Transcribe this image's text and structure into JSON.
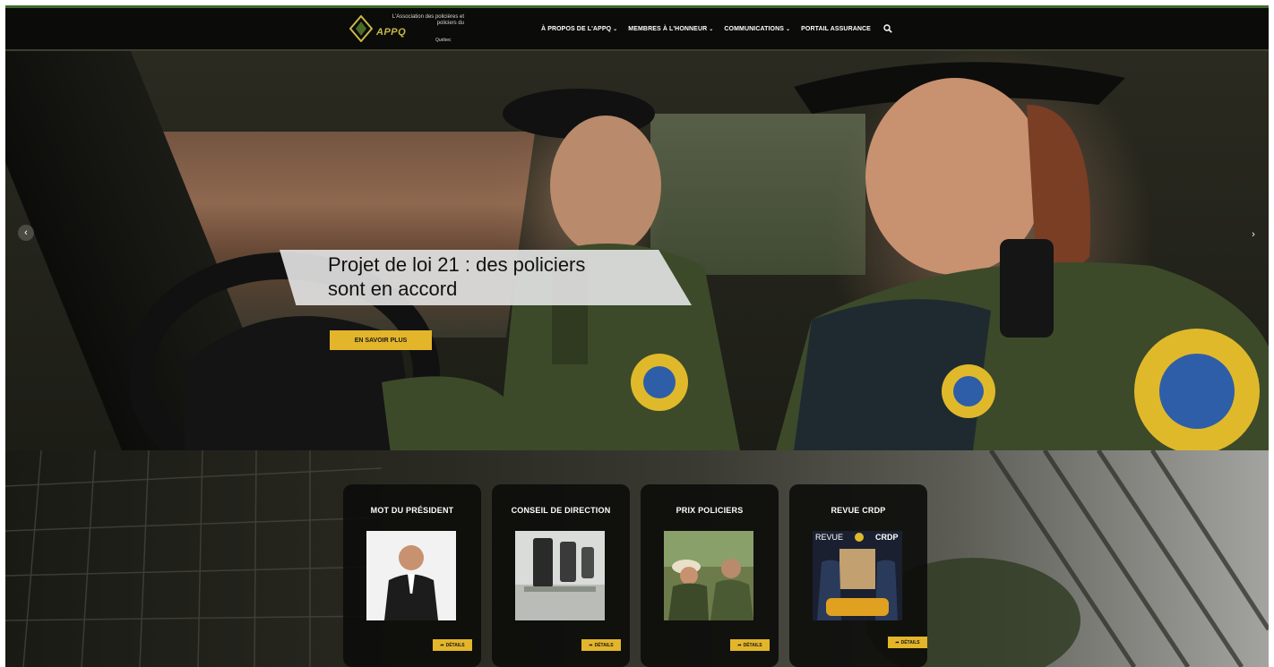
{
  "header": {
    "logo": {
      "small_text": "L'Association des policières et policiers du",
      "name": "APPQ",
      "place": "Québec"
    },
    "nav": [
      {
        "label": "À PROPOS DE L'APPQ",
        "has_dropdown": true
      },
      {
        "label": "MEMBRES À L'HONNEUR",
        "has_dropdown": true
      },
      {
        "label": "COMMUNICATIONS",
        "has_dropdown": true
      },
      {
        "label": "PORTAIL ASSURANCE",
        "has_dropdown": false
      }
    ],
    "search_icon": "search-icon"
  },
  "hero": {
    "title_line1": "Projet de loi 21 : des policiers",
    "title_line2": "sont en accord",
    "cta_label": "EN SAVOIR PLUS",
    "prev_icon": "chevron-left-icon",
    "next_icon": "chevron-right-icon"
  },
  "cards": [
    {
      "title": "MOT DU PRÉSIDENT",
      "button": "DÉTAILS",
      "image": "president-photo"
    },
    {
      "title": "CONSEIL DE DIRECTION",
      "button": "DÉTAILS",
      "image": "boardroom-photo"
    },
    {
      "title": "PRIX POLICIERS",
      "button": "DÉTAILS",
      "image": "officers-photo"
    },
    {
      "title": "REVUE CRDP",
      "button": "DÉTAILS",
      "image": "magazine-cover",
      "magazine": {
        "left": "REVUE",
        "right": "CRDP"
      }
    }
  ],
  "colors": {
    "accent": "#e3b52a",
    "header_bg": "#0b0b09",
    "card_bg": "#0c0c0a",
    "uniform_green": "#3c4a2a"
  }
}
